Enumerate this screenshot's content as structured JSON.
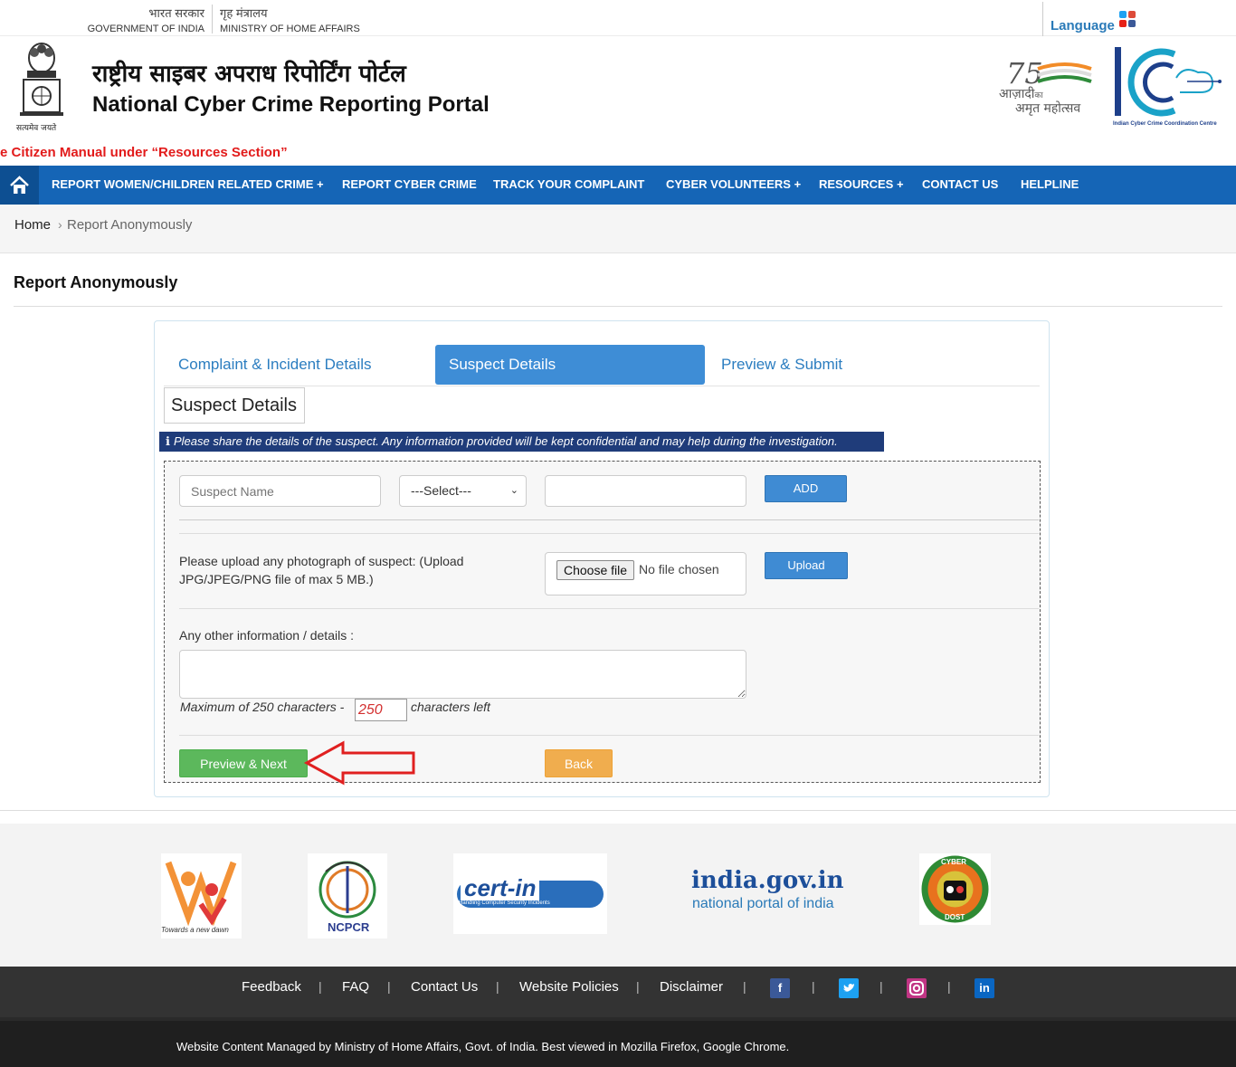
{
  "gov": {
    "india_hi": "भारत सरकार",
    "india_en": "GOVERNMENT OF INDIA",
    "mha_hi": "गृह मंत्रालय",
    "mha_en": "MINISTRY OF HOME AFFAIRS",
    "language": "Language"
  },
  "header": {
    "title_hi": "राष्ट्रीय साइबर अपराध रिपोर्टिंग पोर्टल",
    "title_en": "National Cyber Crime Reporting Portal",
    "emblem_caption": "सत्यमेव जयते",
    "azadi_line1": "आज़ादी",
    "azadi_ka": "का",
    "azadi_line2": "अमृत महोत्सव",
    "i4c_caption": "Indian Cyber Crime Coordination Centre",
    "marquee": "e Citizen Manual under “Resources Section”"
  },
  "nav": {
    "items": [
      {
        "label": "REPORT WOMEN/CHILDREN RELATED CRIME +"
      },
      {
        "label": "REPORT CYBER CRIME"
      },
      {
        "label": "TRACK YOUR COMPLAINT"
      },
      {
        "label": "CYBER VOLUNTEERS +"
      },
      {
        "label": "RESOURCES +"
      },
      {
        "label": "CONTACT US"
      },
      {
        "label": "HELPLINE"
      }
    ]
  },
  "breadcrumb": {
    "home": "Home",
    "separator": "›",
    "current": "Report Anonymously"
  },
  "page": {
    "title": "Report Anonymously"
  },
  "tabs": [
    {
      "label": "Complaint & Incident Details"
    },
    {
      "label": "Suspect Details"
    },
    {
      "label": "Preview & Submit"
    }
  ],
  "form": {
    "section_label": "Suspect Details",
    "info_text": "Please share the details of the suspect. Any information provided will be kept confidential and may help during the investigation.",
    "suspect_name_placeholder": "Suspect Name",
    "select_value": "---Select---",
    "add_label": "ADD",
    "upload_text": "Please upload any photograph of suspect: (Upload JPG/JPEG/PNG file of max 5 MB.)",
    "choose_file": "Choose file",
    "no_file": "No file chosen",
    "upload_label": "Upload",
    "other_info_label": "Any other information / details :",
    "max_chars_prefix": "Maximum of 250 characters -",
    "chars_left_value": "250",
    "chars_left_suffix": "characters left",
    "preview_next": "Preview & Next",
    "back": "Back"
  },
  "partners": {
    "wcd_caption": "Towards a new dawn",
    "ncpcr": "NCPCR",
    "certin": "cert-in",
    "certin_caption": "Handling Computer Security Incidents",
    "india_gov": "india.gov.in",
    "india_gov_sub": "national portal of india",
    "cyberdost_top": "CYBER",
    "cyberdost_bottom": "DOST"
  },
  "footer": {
    "links": [
      {
        "label": "Feedback"
      },
      {
        "label": "FAQ"
      },
      {
        "label": "Contact Us"
      },
      {
        "label": "Website Policies"
      },
      {
        "label": "Disclaimer"
      }
    ],
    "separator": "|",
    "copyright": "Website Content Managed by Ministry of Home Affairs, Govt. of India. Best viewed in Mozilla Firefox, Google Chrome."
  },
  "colors": {
    "nav_blue": "#1565b6",
    "tab_active": "#3e8dd6",
    "info_strip": "#1f3c7a",
    "green_button": "#5cb85c",
    "orange_button": "#f0ad4e",
    "arrow_red": "#e02020"
  }
}
